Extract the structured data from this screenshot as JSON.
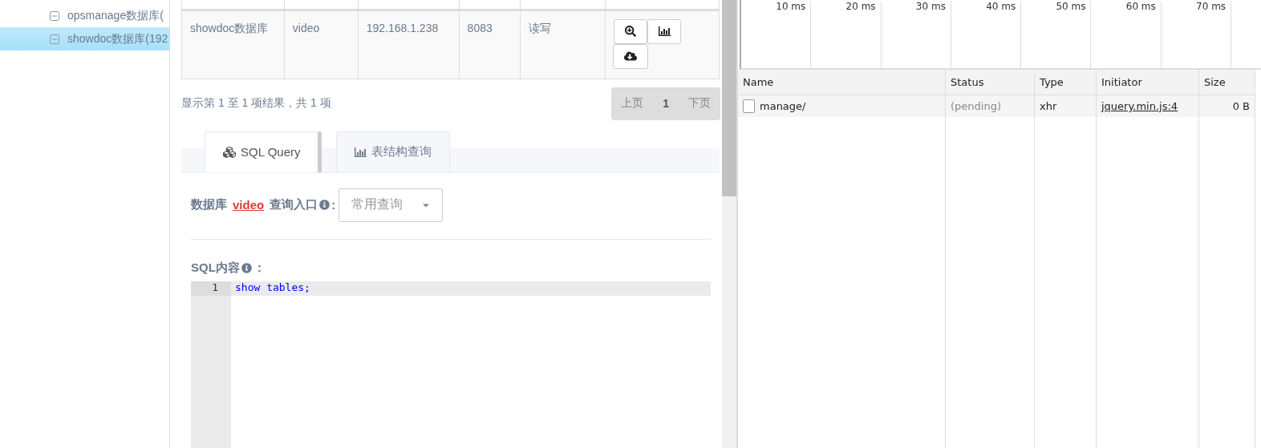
{
  "sidebar": {
    "items": [
      {
        "label": "opsmanage数据库(",
        "selected": false
      },
      {
        "label": "showdoc数据库(192",
        "selected": true
      }
    ]
  },
  "table": {
    "rows": [
      {
        "cells": [
          "showdoc数据库",
          "video",
          "192.168.1.238",
          "8083",
          "读写"
        ]
      }
    ]
  },
  "table_info": "显示第 1 至 1 项结果，共 1 项",
  "pagination": {
    "prev": "上页",
    "pages": [
      {
        "label": "1",
        "selected": true
      }
    ],
    "next": "下页"
  },
  "tabs": [
    {
      "label": "SQL Query",
      "selected": true
    },
    {
      "label": "表结构查询",
      "selected": false
    }
  ],
  "query": {
    "label_prefix": "数据库",
    "database": "video",
    "label_suffix": "查询入口",
    "colon": ":",
    "select": {
      "value": "常用查询"
    }
  },
  "sql": {
    "label": "SQL内容",
    "colon": "：",
    "lines": [
      {
        "number": "1",
        "code": "show tables;"
      }
    ]
  },
  "devtools": {
    "timeline": [
      "10 ms",
      "20 ms",
      "30 ms",
      "40 ms",
      "50 ms",
      "60 ms",
      "70 ms"
    ],
    "columns": [
      "Name",
      "Status",
      "Type",
      "Initiator",
      "Size"
    ],
    "rows": [
      {
        "name": "manage/",
        "status": "(pending)",
        "type": "xhr",
        "initiator": "jquery.min.js:4",
        "size": "0 B"
      }
    ]
  }
}
